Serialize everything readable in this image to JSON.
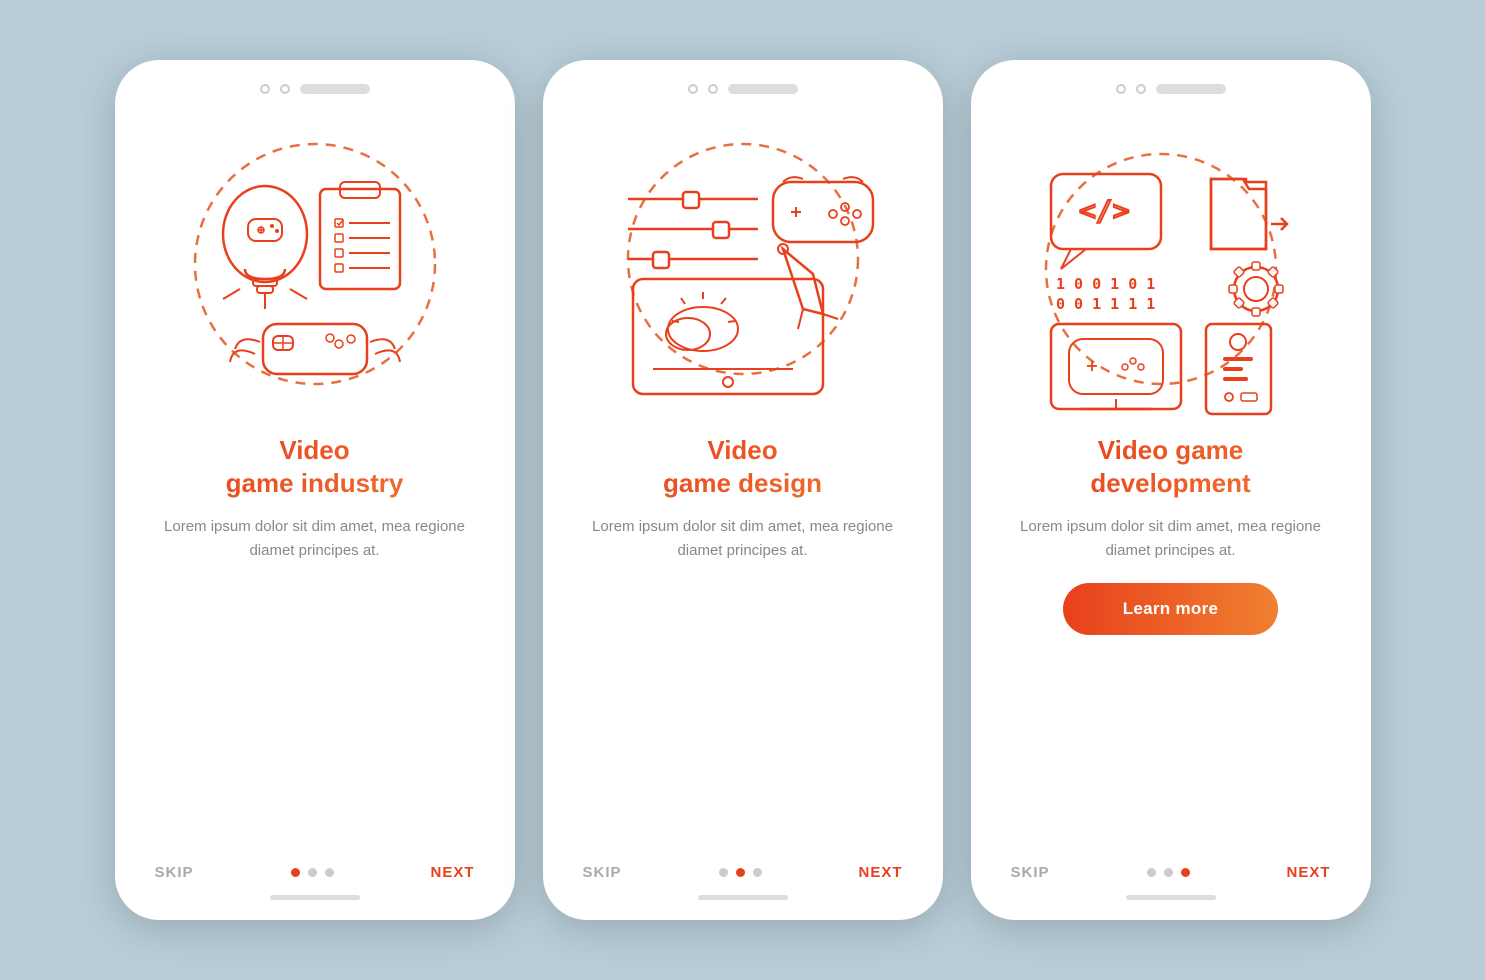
{
  "background": "#b8cdd8",
  "phones": [
    {
      "id": "phone-1",
      "title": "Video\ngame industry",
      "description": "Lorem ipsum dolor sit dim amet, mea regione diamet principes at.",
      "dots": [
        true,
        false,
        false
      ],
      "show_button": false,
      "button_label": null
    },
    {
      "id": "phone-2",
      "title": "Video\ngame design",
      "description": "Lorem ipsum dolor sit dim amet, mea regione diamet principes at.",
      "dots": [
        false,
        true,
        false
      ],
      "show_button": false,
      "button_label": null
    },
    {
      "id": "phone-3",
      "title": "Video game\ndevelopment",
      "description": "Lorem ipsum dolor sit dim amet, mea regione diamet principes at.",
      "dots": [
        false,
        false,
        true
      ],
      "show_button": true,
      "button_label": "Learn more"
    }
  ],
  "nav": {
    "skip_label": "SKIP",
    "next_label": "NEXT"
  }
}
